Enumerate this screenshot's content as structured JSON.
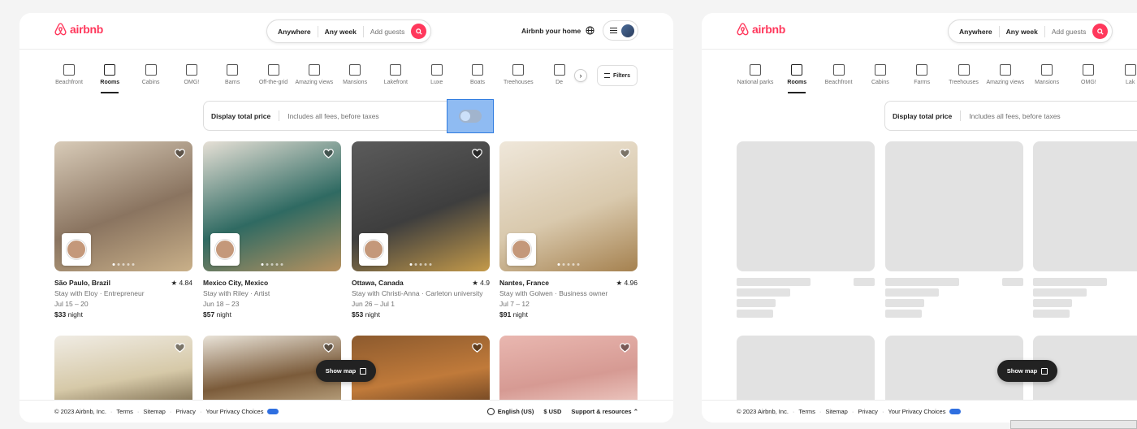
{
  "brand": {
    "name": "airbnb",
    "color": "#ff385c"
  },
  "search": {
    "where": "Anywhere",
    "when": "Any week",
    "guests": "Add guests"
  },
  "header": {
    "host_link": "Airbnb your home",
    "globe_icon": "globe-icon",
    "menu_icon": "hamburger-icon"
  },
  "categories_left": [
    {
      "label": "Beachfront",
      "icon": "beachfront-icon"
    },
    {
      "label": "Rooms",
      "icon": "rooms-icon",
      "active": true
    },
    {
      "label": "Cabins",
      "icon": "cabins-icon"
    },
    {
      "label": "OMG!",
      "icon": "omg-icon"
    },
    {
      "label": "Barns",
      "icon": "barns-icon"
    },
    {
      "label": "Off-the-grid",
      "icon": "off-grid-icon"
    },
    {
      "label": "Amazing views",
      "icon": "views-icon"
    },
    {
      "label": "Mansions",
      "icon": "mansions-icon"
    },
    {
      "label": "Lakefront",
      "icon": "lakefront-icon"
    },
    {
      "label": "Luxe",
      "icon": "luxe-icon"
    },
    {
      "label": "Boats",
      "icon": "boats-icon"
    },
    {
      "label": "Treehouses",
      "icon": "treehouses-icon"
    },
    {
      "label": "De",
      "icon": "design-icon"
    }
  ],
  "categories_right": [
    {
      "label": "National parks",
      "icon": "national-parks-icon"
    },
    {
      "label": "Rooms",
      "icon": "rooms-icon",
      "active": true
    },
    {
      "label": "Beachfront",
      "icon": "beachfront-icon"
    },
    {
      "label": "Cabins",
      "icon": "cabins-icon"
    },
    {
      "label": "Farms",
      "icon": "farms-icon"
    },
    {
      "label": "Treehouses",
      "icon": "treehouses-icon"
    },
    {
      "label": "Amazing views",
      "icon": "views-icon"
    },
    {
      "label": "Mansions",
      "icon": "mansions-icon"
    },
    {
      "label": "OMG!",
      "icon": "omg-icon"
    },
    {
      "label": "Lak",
      "icon": "lakefront-icon"
    }
  ],
  "filters_label": "Filters",
  "price_toggle": {
    "title": "Display total price",
    "subtitle": "Includes all fees, before taxes",
    "on": false
  },
  "listings": [
    {
      "location": "São Paulo, Brazil",
      "rating": "4.84",
      "host": "Stay with Eloy · Entrepreneur",
      "dates": "Jul 15 – 20",
      "price": "$33",
      "unit": "night",
      "colors": [
        "#d8cbb8",
        "#8a7460",
        "#c9b089"
      ]
    },
    {
      "location": "Mexico City, Mexico",
      "rating": "",
      "host": "Stay with Riley · Artist",
      "dates": "Jun 18 – 23",
      "price": "$57",
      "unit": "night",
      "colors": [
        "#e6e0d6",
        "#2f6a62",
        "#b89260"
      ]
    },
    {
      "location": "Ottawa, Canada",
      "rating": "4.9",
      "host": "Stay with Christi-Anna · Carleton university",
      "dates": "Jun 26 – Jul 1",
      "price": "$53",
      "unit": "night",
      "colors": [
        "#5b5b5b",
        "#3e3e3e",
        "#c49a4a"
      ]
    },
    {
      "location": "Nantes, France",
      "rating": "4.96",
      "host": "Stay with Golwen · Business owner",
      "dates": "Jul 7 – 12",
      "price": "$91",
      "unit": "night",
      "colors": [
        "#efe7da",
        "#d9c9ad",
        "#a5814f"
      ]
    }
  ],
  "listings_row2": [
    {
      "colors": [
        "#f0ece4",
        "#d6c9a8",
        "#6b5a3e"
      ]
    },
    {
      "colors": [
        "#e9e3d8",
        "#7b5b3a",
        "#c7b28e"
      ]
    },
    {
      "colors": [
        "#8c5a2e",
        "#c07a3a",
        "#5e3a1e"
      ]
    },
    {
      "colors": [
        "#e9b7b0",
        "#d69a93",
        "#f2d2cb"
      ]
    }
  ],
  "show_map": "Show map",
  "footer": {
    "copyright": "© 2023 Airbnb, Inc.",
    "links": [
      "Terms",
      "Sitemap",
      "Privacy",
      "Your Privacy Choices"
    ],
    "language": "English (US)",
    "currency": "$ USD",
    "support": "Support & resources"
  }
}
